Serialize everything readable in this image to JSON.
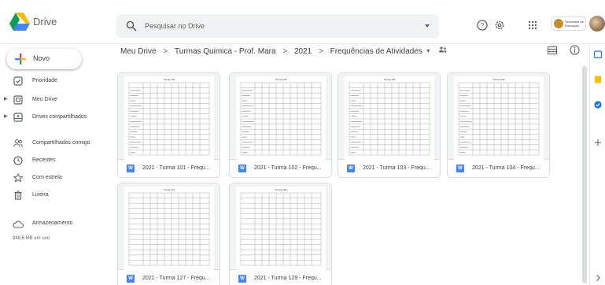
{
  "app": {
    "name": "Drive"
  },
  "search": {
    "placeholder": "Pesquisar no Drive"
  },
  "header": {
    "help_icon": "question-circle-icon",
    "settings_icon": "gear-icon",
    "apps_icon": "grid-icon",
    "account_label": "Secretaria de Educação"
  },
  "sidebar": {
    "new_label": "Novo",
    "items": [
      {
        "label": "Prioridade",
        "icon": "check-circle-icon"
      },
      {
        "label": "Meu Drive",
        "icon": "drive-icon"
      },
      {
        "label": "Drives compartilhados",
        "icon": "shared-drive-icon"
      },
      {
        "label": "Compartilhados comigo",
        "icon": "people-icon"
      },
      {
        "label": "Recentes",
        "icon": "clock-icon"
      },
      {
        "label": "Com estrela",
        "icon": "star-icon"
      },
      {
        "label": "Lixeira",
        "icon": "trash-icon"
      }
    ],
    "storage_label": "Armazenamento",
    "storage_used": "948,6 MB em uso"
  },
  "breadcrumb": {
    "items": [
      "Meu Drive",
      "Turmas Quimica - Prof. Mara",
      "2021",
      "Frequências de Atividades"
    ],
    "separator": ">"
  },
  "files": [
    {
      "name": "2021 - Turma 101 - Frequ...",
      "doc_letter": "W",
      "thumb_title": "Turma 101"
    },
    {
      "name": "2021 - Turma 102 - Frequ...",
      "doc_letter": "W",
      "thumb_title": "Turma 102"
    },
    {
      "name": "2021 - Turma 103 - Frequ...",
      "doc_letter": "W",
      "thumb_title": "Turma 103"
    },
    {
      "name": "2021 - Turma 104 - Frequ...",
      "doc_letter": "W",
      "thumb_title": "Turma 104"
    },
    {
      "name": "2021 - Turma 127 - Frequ...",
      "doc_letter": "W",
      "thumb_title": "Turma 127"
    },
    {
      "name": "2021 - Turma 129 - Frequ...",
      "doc_letter": "W",
      "thumb_title": "Turma 129"
    }
  ],
  "colors": {
    "accent": "#1a73e8",
    "doc_blue": "#4285f4",
    "rail_keep": "#fbbc04",
    "rail_tasks": "#1a73e8"
  }
}
